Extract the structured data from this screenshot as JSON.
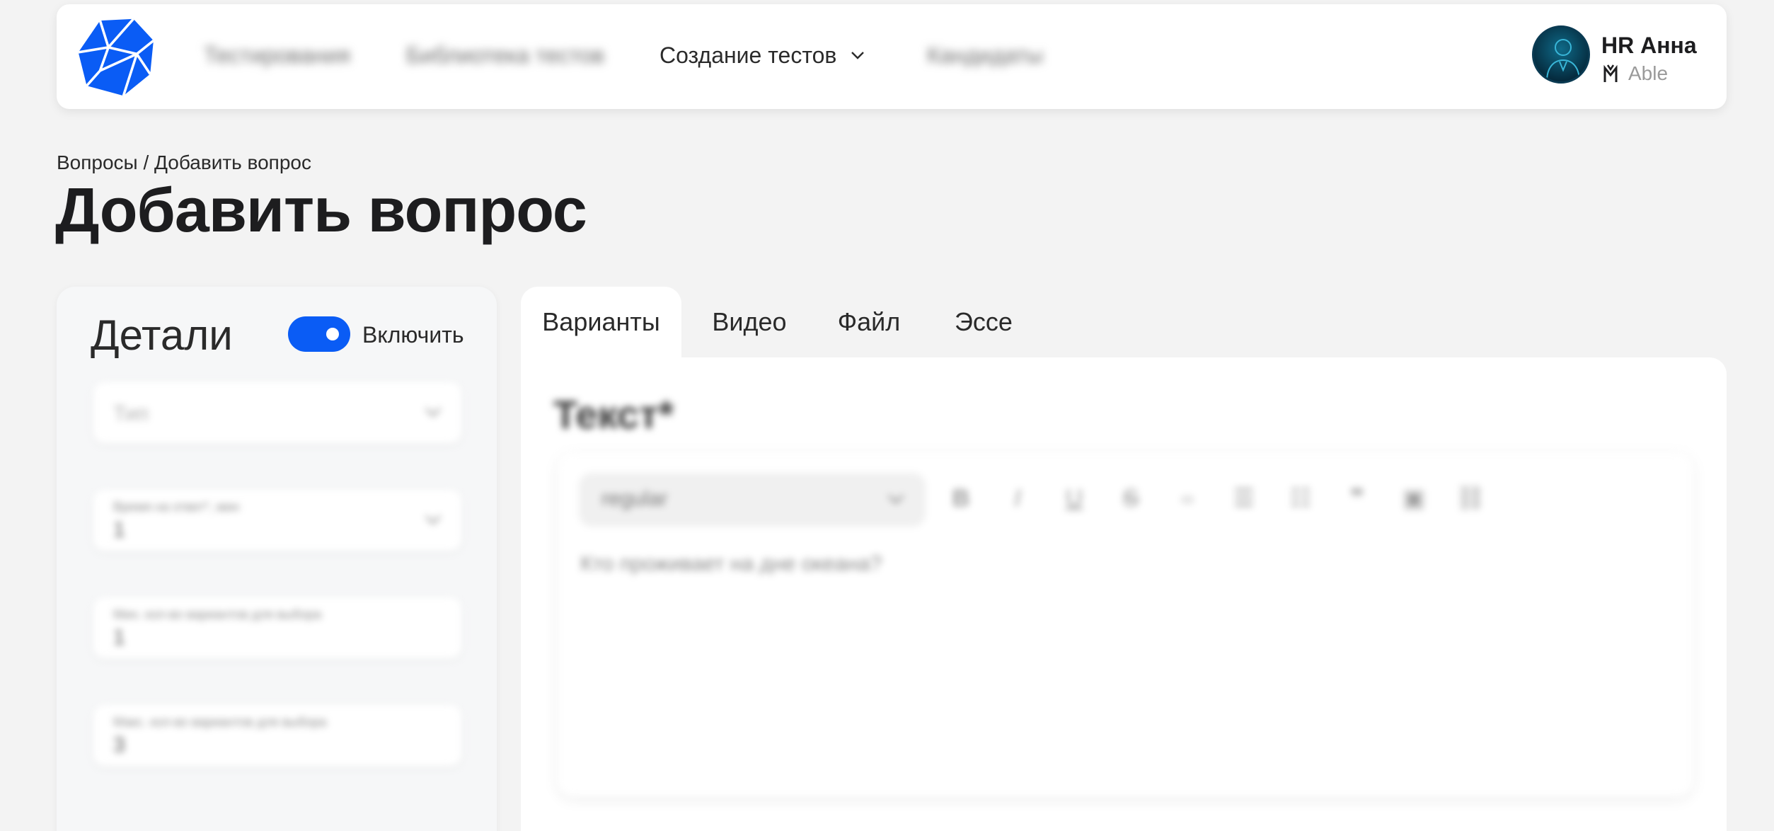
{
  "nav": {
    "items": [
      {
        "label": "Тестирования"
      },
      {
        "label": "Библиотека тестов"
      },
      {
        "label": "Создание тестов"
      },
      {
        "label": "Кандидаты"
      }
    ]
  },
  "user": {
    "name": "HR Анна",
    "company": "Able"
  },
  "breadcrumb": "Вопросы / Добавить вопрос",
  "page_title": "Добавить вопрос",
  "details": {
    "title": "Детали",
    "toggle_label": "Включить",
    "toggle_on": true,
    "fields": [
      {
        "label": "",
        "value": "",
        "placeholder": "Тип"
      },
      {
        "label": "Время на ответ*, мин",
        "value": "1",
        "placeholder": ""
      },
      {
        "label": "Мин. кол-во вариантов для выбора",
        "value": "1",
        "placeholder": ""
      },
      {
        "label": "Макс. кол-во вариантов для выбора",
        "value": "3",
        "placeholder": ""
      }
    ]
  },
  "tabs": [
    {
      "label": "Варианты",
      "active": true
    },
    {
      "label": "Видео",
      "active": false
    },
    {
      "label": "Файл",
      "active": false
    },
    {
      "label": "Эссе",
      "active": false
    }
  ],
  "editor": {
    "label": "Текст*",
    "format_value": "regular",
    "text": "Кто проживает на дне океана?",
    "toolbar": [
      "bold-icon",
      "italic-icon",
      "underline-icon",
      "strikethrough-icon",
      "code-icon",
      "bullet-list-icon",
      "numbered-list-icon",
      "quote-icon",
      "image-icon",
      "link-icon"
    ]
  },
  "colors": {
    "accent": "#0a5cf5",
    "background": "#f3f3f3"
  }
}
